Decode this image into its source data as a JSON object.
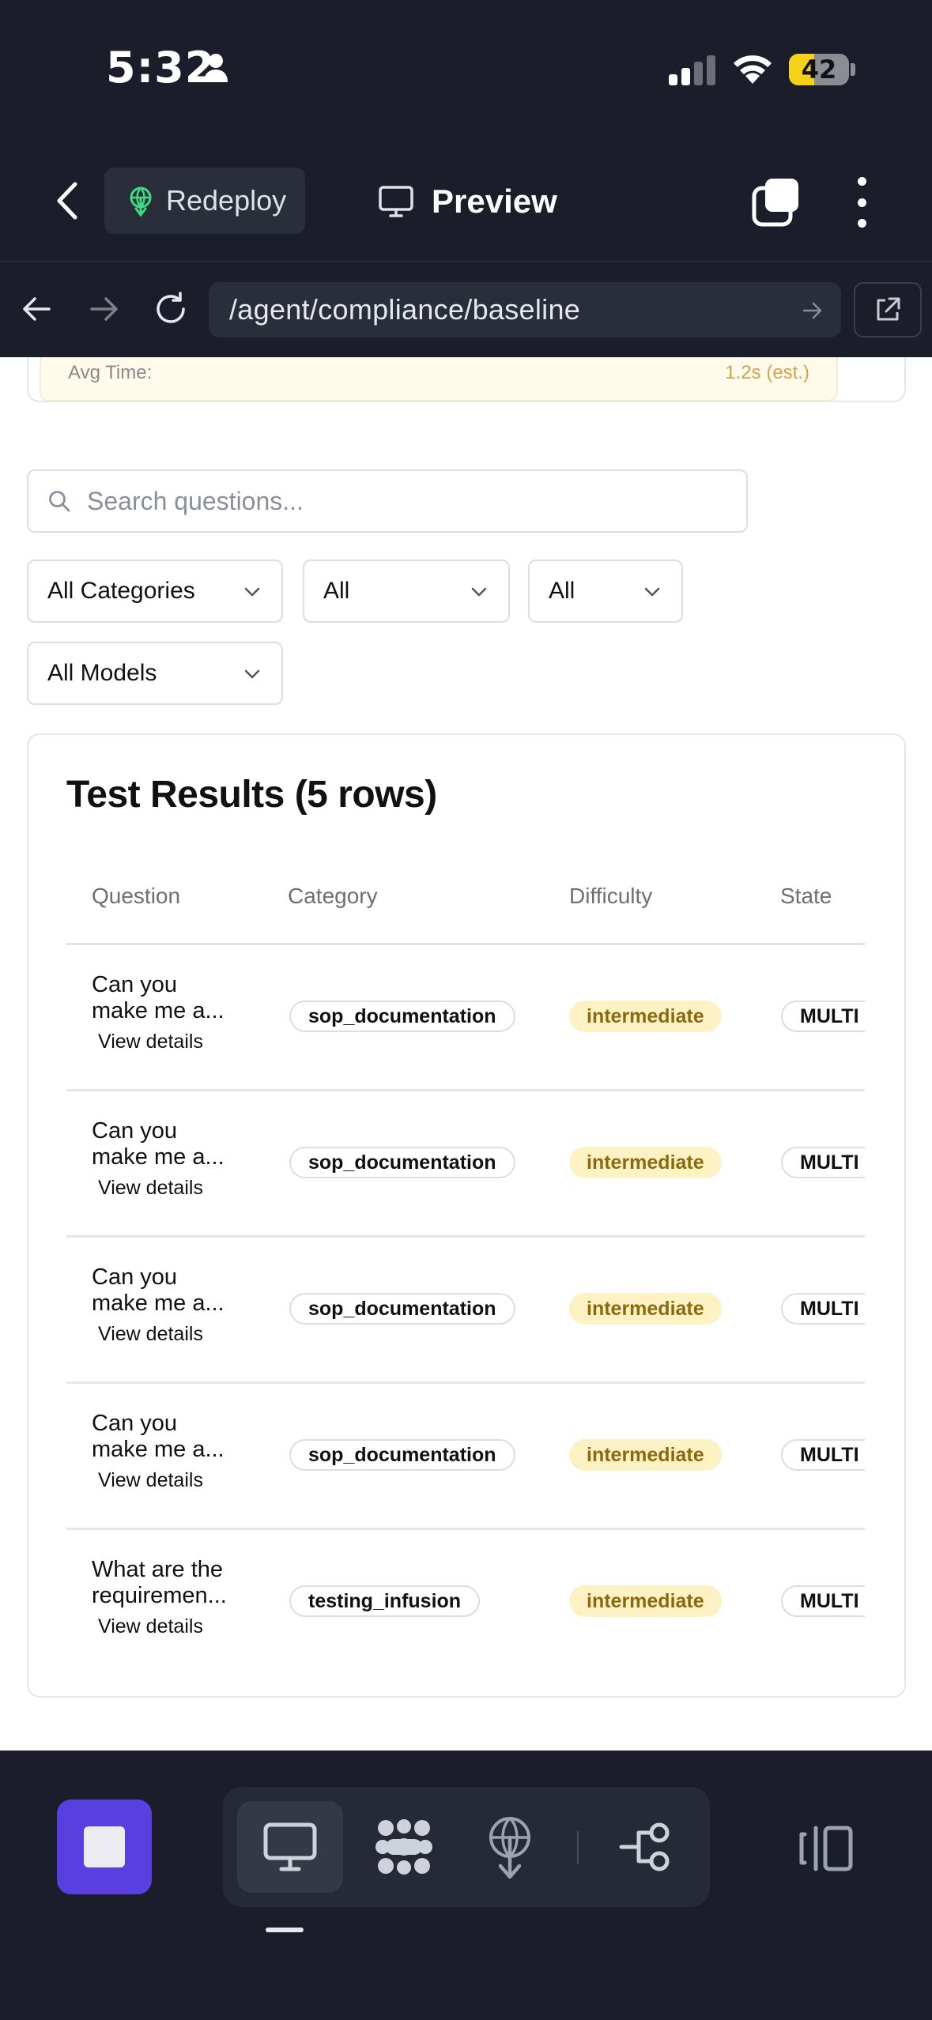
{
  "status_bar": {
    "time": "5:32",
    "battery": "42",
    "battery_level": 0.42
  },
  "header": {
    "redeploy_label": "Redeploy",
    "preview_label": "Preview"
  },
  "browser": {
    "url": "/agent/compliance/baseline"
  },
  "summary": {
    "avg_time_label": "Avg Time:",
    "avg_time_value": "1.2s (est.)"
  },
  "filters": {
    "search_placeholder": "Search questions...",
    "category": "All Categories",
    "difficulty": "All",
    "state": "All",
    "model": "All Models"
  },
  "results": {
    "title": "Test Results (5 rows)",
    "columns": [
      "Question",
      "Category",
      "Difficulty",
      "State"
    ],
    "view_details": "View details",
    "rows": [
      {
        "q1": "Can you",
        "q2": "make me a...",
        "category": "sop_documentation",
        "difficulty": "intermediate",
        "state": "MULTI"
      },
      {
        "q1": "Can you",
        "q2": "make me a...",
        "category": "sop_documentation",
        "difficulty": "intermediate",
        "state": "MULTI"
      },
      {
        "q1": "Can you",
        "q2": "make me a...",
        "category": "sop_documentation",
        "difficulty": "intermediate",
        "state": "MULTI"
      },
      {
        "q1": "Can you",
        "q2": "make me a...",
        "category": "sop_documentation",
        "difficulty": "intermediate",
        "state": "MULTI"
      },
      {
        "q1": "What are the",
        "q2": "requiremen...",
        "category": "testing_infusion",
        "difficulty": "intermediate",
        "state": "MULTI"
      }
    ]
  },
  "colors": {
    "chrome_bg": "#1b1e2a",
    "accent_stop": "#5a3fe0",
    "difficulty_bg": "#fdf2c4",
    "difficulty_text": "#8b6a0f",
    "redeploy_icon": "#3ddc84"
  },
  "icons": {
    "toolbar": [
      "monitor-icon",
      "apps-grid-icon",
      "deploy-icon",
      "workflow-icon"
    ],
    "panel": "side-panel-icon"
  }
}
